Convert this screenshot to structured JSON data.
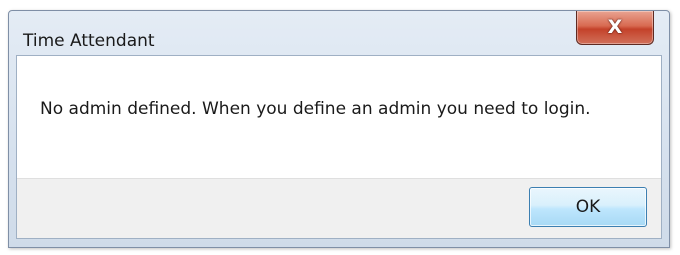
{
  "dialog": {
    "title": "Time Attendant",
    "message": "No admin defined. When you define an admin you need to login.",
    "ok_label": "OK",
    "close_glyph": "X"
  },
  "icons": {
    "close": "close-icon"
  },
  "colors": {
    "close_button": "#c4422a",
    "ok_button_border": "#3c7fb1",
    "frame": "#d6e1ee",
    "button_area": "#f0f0f0"
  }
}
